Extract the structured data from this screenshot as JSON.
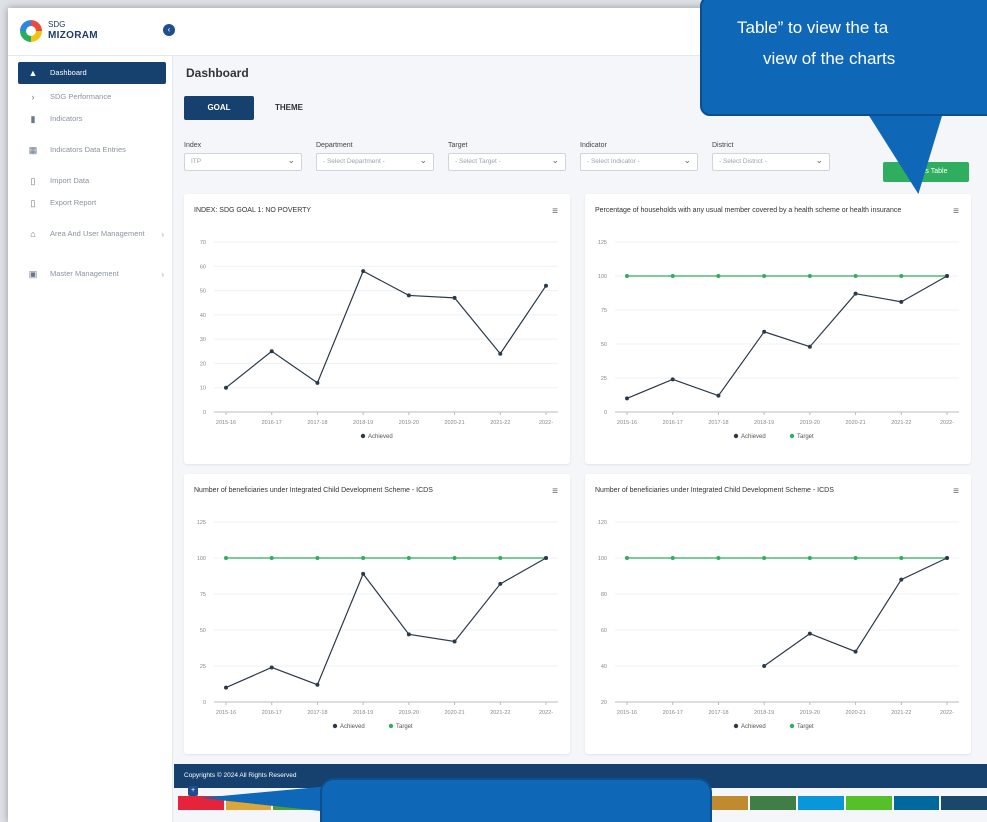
{
  "brand": {
    "sdg": "SDG",
    "name": "MIZORAM"
  },
  "sidebar": {
    "items": [
      {
        "label": "Dashboard",
        "icon": "dashboard-icon",
        "glyph": "▲"
      },
      {
        "label": "SDG Performance",
        "icon": "chevron-right-icon",
        "glyph": "›"
      },
      {
        "label": "Indicators",
        "icon": "document-icon",
        "glyph": "▮"
      },
      {
        "label": "Indicators Data Entries",
        "icon": "table-icon",
        "glyph": "▦"
      },
      {
        "label": "Import Data",
        "icon": "file-icon",
        "glyph": "▯"
      },
      {
        "label": "Export Report",
        "icon": "report-icon",
        "glyph": "▯"
      },
      {
        "label": "Area And User Management",
        "icon": "home-icon",
        "glyph": "⌂"
      },
      {
        "label": "Master Management",
        "icon": "settings-icon",
        "glyph": "▣"
      }
    ]
  },
  "main": {
    "title": "Dashboard",
    "tabs": [
      {
        "label": "GOAL"
      },
      {
        "label": "THEME"
      }
    ],
    "filters": [
      {
        "label": "Index",
        "value": "ITP"
      },
      {
        "label": "Department",
        "value": "- Select Department -"
      },
      {
        "label": "Target",
        "value": "- Select Target -"
      },
      {
        "label": "Indicator",
        "value": "- Select Indicator -"
      },
      {
        "label": "District",
        "value": "- Select District -"
      }
    ],
    "view_table_label": "View as Table"
  },
  "footer": {
    "copyright": "Copyrights © 2024 All Rights Reserved"
  },
  "callout": {
    "line1": "Table” to view the ta",
    "line2": "view of the charts"
  },
  "colors": {
    "navy": "#16406e",
    "green": "#2eae5e",
    "callout": "#0f67b7",
    "achieved": "#2b3a4a",
    "target": "#2eae5e"
  },
  "chart_data": [
    {
      "type": "line",
      "title": "INDEX: SDG GOAL 1: NO POVERTY",
      "x": [
        "2015-16",
        "2016-17",
        "2017-18",
        "2018-19",
        "2019-20",
        "2020-21",
        "2021-22",
        "2022-"
      ],
      "ylim": [
        0,
        70
      ],
      "yticks": [
        0,
        10,
        20,
        30,
        40,
        50,
        60,
        70
      ],
      "legend": "bottom",
      "series": [
        {
          "name": "Achieved",
          "values": [
            10,
            25,
            12,
            58,
            48,
            47,
            24,
            52
          ]
        }
      ]
    },
    {
      "type": "line",
      "title": "Percentage of households with any usual member covered by a health scheme or health insurance",
      "x": [
        "2015-16",
        "2016-17",
        "2017-18",
        "2018-19",
        "2019-20",
        "2020-21",
        "2021-22",
        "2022-"
      ],
      "ylim": [
        0,
        125
      ],
      "yticks": [
        0,
        25,
        50,
        75,
        100,
        125
      ],
      "legend": "bottom",
      "series": [
        {
          "name": "Achieved",
          "values": [
            10,
            24,
            12,
            59,
            48,
            87,
            81,
            100
          ]
        },
        {
          "name": "Target",
          "values": [
            100,
            100,
            100,
            100,
            100,
            100,
            100,
            100
          ]
        }
      ]
    },
    {
      "type": "line",
      "title": "Number of beneficiaries under Integrated Child Development Scheme - ICDS",
      "x": [
        "2015-16",
        "2016-17",
        "2017-18",
        "2018-19",
        "2019-20",
        "2020-21",
        "2021-22",
        "2022-"
      ],
      "ylim": [
        0,
        125
      ],
      "yticks": [
        0,
        25,
        50,
        75,
        100,
        125
      ],
      "legend": "bottom",
      "series": [
        {
          "name": "Achieved",
          "values": [
            10,
            24,
            12,
            89,
            47,
            42,
            82,
            100
          ]
        },
        {
          "name": "Target",
          "values": [
            100,
            100,
            100,
            100,
            100,
            100,
            100,
            100
          ]
        }
      ]
    },
    {
      "type": "line",
      "title": "Number of beneficiaries under Integrated Child Development Scheme - ICDS",
      "x": [
        "2015-16",
        "2016-17",
        "2017-18",
        "2018-19",
        "2019-20",
        "2020-21",
        "2021-22",
        "2022-"
      ],
      "ylim": [
        20,
        120
      ],
      "yticks": [
        20,
        40,
        60,
        80,
        100,
        120
      ],
      "legend": "bottom",
      "series": [
        {
          "name": "Achieved",
          "values": [
            null,
            null,
            null,
            40,
            58,
            48,
            88,
            100
          ]
        },
        {
          "name": "Target",
          "values": [
            100,
            100,
            100,
            100,
            100,
            100,
            100,
            100
          ]
        }
      ]
    }
  ]
}
